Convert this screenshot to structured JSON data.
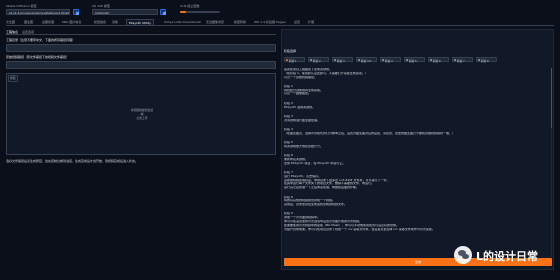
{
  "top": {
    "model_label": "Stable Diffusion 模型",
    "model_value": "sd-v1-5-pruned-emaonly.safetensors [6ce0161689]",
    "vae_label": "SD VAE 模型",
    "vae_value": "Automatic",
    "clip_label": "CLIP 终止层数",
    "clip_fraction": 0.15
  },
  "tabs": [
    "文生图",
    "图生图",
    "后期处理",
    "PNG 图片信息",
    "模型融合",
    "训练",
    "Ebsynth Utility",
    "Kohya LoRA Dreambooth",
    "无边图像浏览",
    "模型转换",
    "WD 1.4 标签器 Tagger",
    "设置",
    "扩展"
  ],
  "active_tab": "Ebsynth Utility",
  "left": {
    "subtabs": [
      "工程信息",
      "设置选项"
    ],
    "project_label": "工程目录（注意不要带中文、下面的所有路径同理）",
    "video_label": "原始视频路径（原文件路径下的视频文件路径）",
    "upload_tag": "视频",
    "upload_hint_1": "将视频拖放到此处",
    "upload_hint_2": "-或-",
    "upload_hint_3": "点击上传",
    "bottom_hint": "选好文件路径后点生成按钮，会在控制台看到进度，生成完成后才会开始，到视频完成后进入状态。"
  },
  "right": {
    "stage_label": "阶段选择",
    "stages": [
      "阶段 1",
      "阶段 2",
      "阶段 3",
      "阶段 3.5",
      "阶段 4",
      "阶段 5",
      "阶段 6",
      "阶段 7",
      "阶段 8"
    ],
    "lines": [
      "首先在项目工程路径下生成关键帧。",
      "（在阶段 1，使用默认设置即可，不需要打开蒙版生成选项。）",
      "以及一个原始视频路径。",
      "",
      "阶段 1",
      "将视频分割成帧并生成蒙版。",
      "以及一个图像路径。",
      "",
      "阶段 2",
      "Ebsynth 选择关键帧。",
      "",
      "阶段 3",
      "对关键帧进行图生图处理。",
      "",
      "阶段 4",
      "（在图生图页，选择背景模式并打开脚本之后，设置为图生图对应的设置，请注意，这里的图生图尺寸要和原始视频保持一致。）",
      "",
      "阶段 5",
      "将关键帧放大恢复原始尺寸。",
      "",
      "阶段 6",
      "重新命名关键帧。",
      "生成 EbSynth 项目，在 Ebsynth 中运行它。",
      "",
      "阶段 7",
      "运行 Ebsynth，点击保存。",
      "完整的视频处理好后，你的目录下会多出 out-### 文件夹，可以进行下一步。",
      "在其中运行每个文件夹下的项目文件，删除不需要的文件，再运行。",
      "运行完之后处理一下之后再来处理，再继续后面的步骤。",
      "",
      "阶段 8",
      "将所有完成的视频帧合并成一个视频。",
      "完成后，目录里就会生成最终合成的视频文件。",
      "",
      "阶段 9",
      "添加一个背景图到视频中。",
      "你可以在设置里的背景选项中设置背景图片或者背景视频。",
      "如果要使用背景视频中的蒙版（BG Mask），你可以手动或使用遮罩以设定好的合成。",
      "为提升合成效果，你可以在项目目录下创建一个 inv 蒙版文件夹，在设置页里选择 inv 蒙版文件夹作为背景蒙版。"
    ],
    "generate_label": "生成"
  },
  "watermark_text": "L的设计日常"
}
